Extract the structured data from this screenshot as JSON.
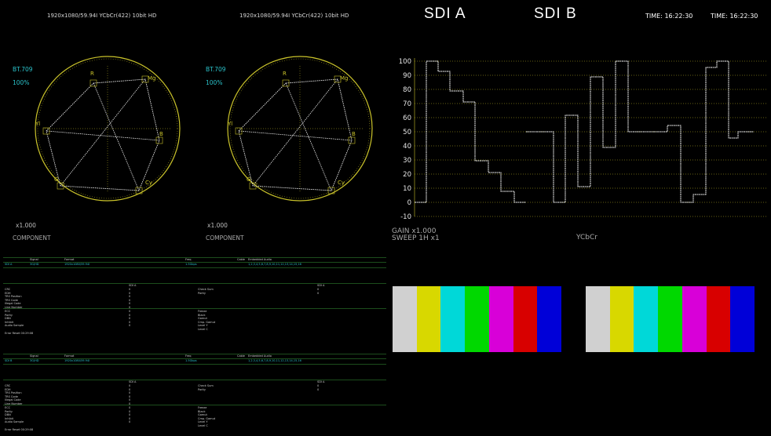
{
  "header": {
    "format_left": "1920x1080/59.94I YCbCr(422) 10bit HD",
    "format_right": "1920x1080/59.94I YCbCr(422) 10bit HD",
    "sdi_a": "SDI A",
    "sdi_b": "SDI B",
    "time_a": "TIME: 16:22:30",
    "time_b": "TIME: 16:22:30"
  },
  "vectorscopes": [
    {
      "standard": "BT.709",
      "percent": "100%",
      "gain": "x1.000",
      "mode": "COMPONENT"
    },
    {
      "standard": "BT.709",
      "percent": "100%",
      "gain": "x1.000",
      "mode": "COMPONENT"
    }
  ],
  "vector_labels": {
    "R": "R",
    "Mg": "Mg",
    "B": "B",
    "Cy": "Cy",
    "G": "G",
    "Yl": "Yl"
  },
  "waveform": {
    "scale": [
      "100",
      "90",
      "80",
      "70",
      "60",
      "50",
      "40",
      "30",
      "20",
      "10",
      "0",
      "-10"
    ],
    "gain": "GAIN x1.000",
    "sweep": "SWEEP 1H x1",
    "colorspace": "YCbCr"
  },
  "colors": {
    "bars": [
      "#d0d0d0",
      "#d8d800",
      "#00d8d8",
      "#00d800",
      "#d800d8",
      "#d80000",
      "#0000d8"
    ],
    "scope_ring": "#c9c22a",
    "cyan": "#2bc4cc",
    "grid": "#c9c22a"
  },
  "status_panels": [
    {
      "header": [
        "Signal",
        "Format",
        "Freq",
        "Cable",
        "Embedded Audio"
      ],
      "row": [
        "SDI A",
        "3G/HD",
        "1920x1080/59.94I",
        "1.5Gbps",
        "",
        "1,2,3,4,5,6,7,8,9,10,11,12,13,14,15,16"
      ],
      "left_items": [
        "CRC",
        "EDH",
        "TRS Position",
        "TRS Code",
        "Illegal Code",
        "Line Number"
      ],
      "left_items2": [
        "ECC",
        "Parity",
        "DBN",
        "Inhibit",
        "Audio Sample"
      ],
      "right_items": [
        "Check Sum",
        "Parity"
      ],
      "right_items2": [
        "Freeze",
        "Black",
        "Gamut",
        "Cmp. Gamut",
        "Level Y",
        "Level C"
      ],
      "footer": "Error Reset 00:29:08"
    },
    {
      "header": [
        "Signal",
        "Format",
        "Freq",
        "Cable",
        "Embedded Audio"
      ],
      "row": [
        "SDI B",
        "3G/HD",
        "1920x1080/59.94I",
        "1.5Gbps",
        "",
        "1,2,3,4,5,6,7,8,9,10,11,12,13,14,15,16"
      ],
      "left_items": [
        "CRC",
        "EDH",
        "TRS Position",
        "TRS Code",
        "Illegal Code",
        "Line Number"
      ],
      "left_items2": [
        "ECC",
        "Parity",
        "DBN",
        "Inhibit",
        "Audio Sample"
      ],
      "right_items": [
        "Check Sum",
        "Parity"
      ],
      "right_items2": [
        "Freeze",
        "Black",
        "Gamut",
        "Cmp. Gamut",
        "Level Y",
        "Level C"
      ],
      "footer": "Error Reset 00:29:08"
    }
  ]
}
